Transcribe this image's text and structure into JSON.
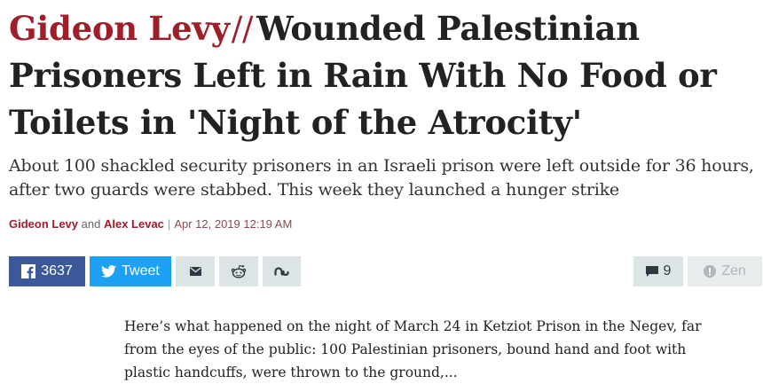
{
  "article": {
    "kicker": "Gideon Levy",
    "separator": "//",
    "headline": "Wounded Palestinian Prisoners Left in Rain With No Food or Toilets in 'Night of the Atrocity'",
    "subhead": "About 100 shackled security prisoners in an Israeli prison were left outside for 36 hours, after two guards were stabbed. This week they launched a hunger strike",
    "byline": {
      "author1": "Gideon Levy",
      "and": "and",
      "author2": "Alex Levac",
      "separator": "|",
      "date": "Apr 12, 2019 12:19 AM"
    },
    "lead": "Here’s what happened on the night of March 24 in Ketziot Prison in the Negev, far from the eyes of the public: 100 Palestinian prisoners, bound hand and foot with plastic handcuffs, were thrown to the ground,..."
  },
  "share": {
    "facebook_count": "3637",
    "twitter_label": "Tweet",
    "comments_count": "9",
    "zen_label": "Zen"
  },
  "colors": {
    "accent": "#a01d2a",
    "facebook": "#3b5998",
    "twitter": "#1da1f2",
    "button_gray": "#dde4e6"
  },
  "icons": {
    "facebook": "facebook-icon",
    "twitter": "twitter-icon",
    "email": "email-icon",
    "reddit": "reddit-icon",
    "stumbleupon": "stumbleupon-icon",
    "comments": "comment-icon",
    "zen": "zen-icon"
  }
}
